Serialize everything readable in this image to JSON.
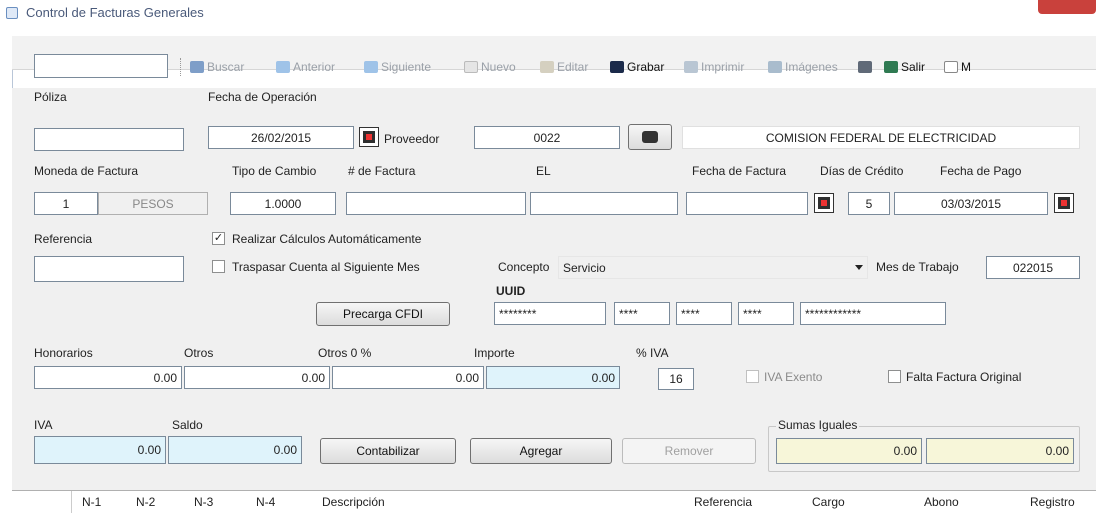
{
  "window": {
    "title": "Control de Facturas Generales"
  },
  "toolbar": {
    "search_value": "",
    "buscar": "Buscar",
    "anterior": "Anterior",
    "siguiente": "Siguiente",
    "nuevo": "Nuevo",
    "editar": "Editar",
    "grabar": "Grabar",
    "imprimir": "Imprimir",
    "imagenes": "Imágenes",
    "salir": "Salir",
    "m": "M"
  },
  "form": {
    "poliza_label": "Póliza",
    "poliza_value": "",
    "fecha_operacion_label": "Fecha de Operación",
    "fecha_operacion_value": "26/02/2015",
    "proveedor_label": "Proveedor",
    "proveedor_code": "0022",
    "proveedor_name": "COMISION FEDERAL DE ELECTRICIDAD",
    "moneda_label": "Moneda de Factura",
    "moneda_code": "1",
    "moneda_name": "PESOS",
    "tipo_cambio_label": "Tipo de Cambio",
    "tipo_cambio_value": "1.0000",
    "num_factura_label": "# de Factura",
    "num_factura_value": "",
    "el_label": "EL",
    "el_value": "",
    "fecha_factura_label": "Fecha de Factura",
    "fecha_factura_value": "",
    "dias_credito_label": "Días de Crédito",
    "dias_credito_value": "5",
    "fecha_pago_label": "Fecha de Pago",
    "fecha_pago_value": "03/03/2015",
    "referencia_label": "Referencia",
    "referencia_value": "",
    "realizar_calculos_label": "Realizar Cálculos Automáticamente",
    "realizar_calculos_checked": "✓",
    "traspasar_label": "Traspasar Cuenta al Siguiente Mes",
    "concepto_label": "Concepto",
    "concepto_value": "Servicio",
    "mes_trabajo_label": "Mes de Trabajo",
    "mes_trabajo_value": "022015",
    "uuid_label": "UUID",
    "uuid_parts": [
      "********",
      "****",
      "****",
      "****",
      "************"
    ],
    "precarga_button": "Precarga CFDI",
    "honorarios_label": "Honorarios",
    "honorarios_value": "0.00",
    "otros_label": "Otros",
    "otros_value": "0.00",
    "otros0_label": "Otros 0 %",
    "otros0_value": "0.00",
    "importe_label": "Importe",
    "importe_value": "0.00",
    "iva_pct_label": "% IVA",
    "iva_pct_value": "16",
    "iva_exento_label": "IVA Exento",
    "falta_factura_label": "Falta Factura Original",
    "iva_label": "IVA",
    "iva_value": "0.00",
    "saldo_label": "Saldo",
    "saldo_value": "0.00",
    "contabilizar_button": "Contabilizar",
    "agregar_button": "Agregar",
    "remover_button": "Remover",
    "sumas_label": "Sumas Iguales",
    "sumas_cargo": "0.00",
    "sumas_abono": "0.00"
  },
  "grid": {
    "columns": [
      "N-1",
      "N-2",
      "N-3",
      "N-4",
      "Descripción",
      "Referencia",
      "Cargo",
      "Abono",
      "Registro"
    ]
  }
}
